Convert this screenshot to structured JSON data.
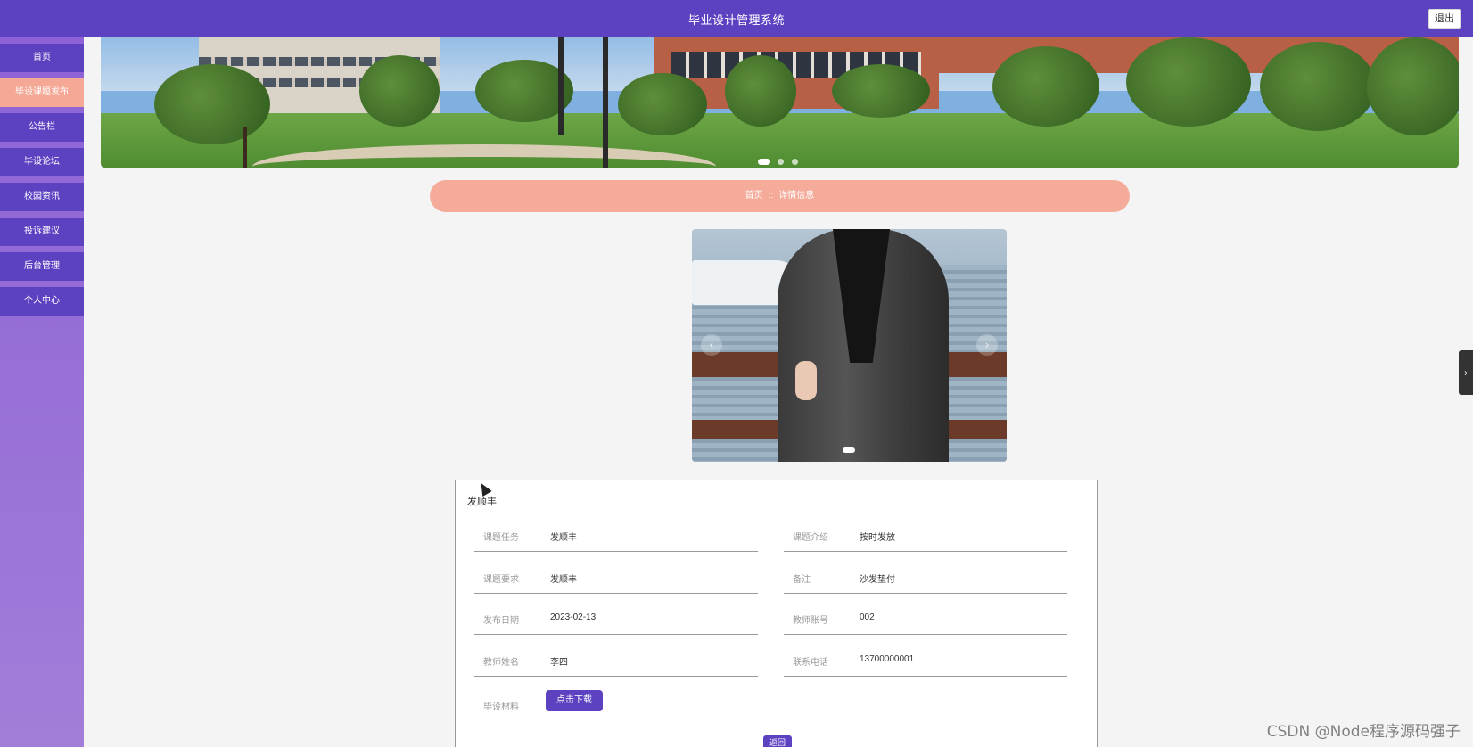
{
  "header": {
    "title": "毕业设计管理系统",
    "logout_label": "退出"
  },
  "sidebar": {
    "items": [
      {
        "label": "首页",
        "active": false
      },
      {
        "label": "毕设课题发布",
        "active": true
      },
      {
        "label": "公告栏",
        "active": false
      },
      {
        "label": "毕设论坛",
        "active": false
      },
      {
        "label": "校园资讯",
        "active": false
      },
      {
        "label": "投诉建议",
        "active": false
      },
      {
        "label": "后台管理",
        "active": false
      },
      {
        "label": "个人中心",
        "active": false
      }
    ]
  },
  "banner": {
    "slides": 3,
    "active_slide": 1
  },
  "breadcrumb": {
    "home": "首页",
    "separator": "::",
    "current": "详情信息"
  },
  "detail": {
    "heading": "发顺丰",
    "fields": [
      {
        "label": "课题任务",
        "value": "发顺丰"
      },
      {
        "label": "课题介绍",
        "value": "按时发放"
      },
      {
        "label": "课题要求",
        "value": "发顺丰"
      },
      {
        "label": "备注",
        "value": "沙发垫付"
      },
      {
        "label": "发布日期",
        "value": "2023-02-13"
      },
      {
        "label": "教师账号",
        "value": "002"
      },
      {
        "label": "教师姓名",
        "value": "李四"
      },
      {
        "label": "联系电话",
        "value": "13700000001"
      }
    ],
    "material_label": "毕设材料",
    "download_label": "点击下载",
    "back_label": "返回"
  },
  "watermark": "CSDN @Node程序源码强子",
  "colors": {
    "primary": "#5c41c1",
    "accent": "#f5ab9a",
    "sidebar_bg": "#a27ed8"
  }
}
